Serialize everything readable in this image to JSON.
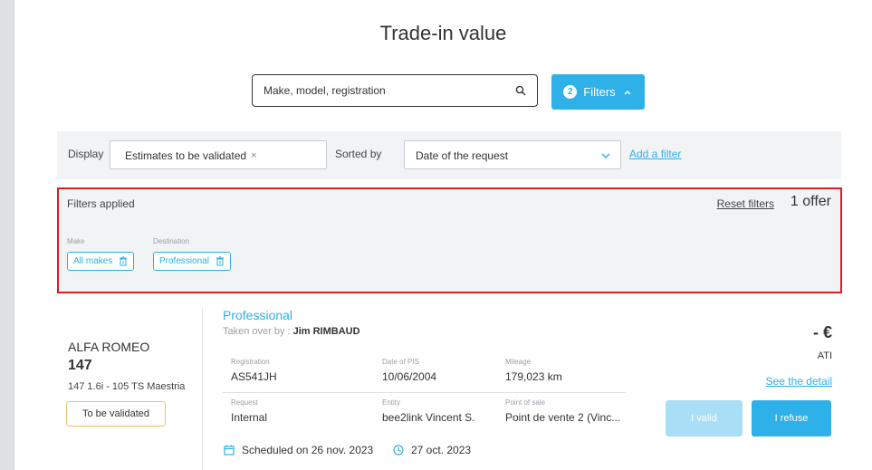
{
  "page": {
    "title": "Trade-in value"
  },
  "search": {
    "placeholder": "Make, model, registration",
    "icon": "search-icon"
  },
  "filters_button": {
    "count": "2",
    "label": "Filters",
    "icon": "chevron-up-icon"
  },
  "display_bar": {
    "display_label": "Display",
    "display_chip": "Estimates to be validated",
    "display_chip_remove": "×",
    "sorted_by_label": "Sorted by",
    "sort_value": "Date of the request",
    "add_filter_label": "Add a filter"
  },
  "filters_applied": {
    "title": "Filters applied",
    "reset_label": "Reset filters",
    "offer_count": "1 offer",
    "filters": [
      {
        "label": "Make",
        "value": "All makes"
      },
      {
        "label": "Destination",
        "value": "Professional"
      }
    ]
  },
  "offer": {
    "make": "ALFA ROMEO",
    "model": "147",
    "version": "147 1.6i - 105 TS Maestria",
    "status": "To be validated",
    "destination": "Professional",
    "taken_over_label": "Taken over by :",
    "taken_over_by": "Jim RIMBAUD",
    "registration_label": "Registration",
    "registration": "AS541JH",
    "date_pis_label": "Date of PIS",
    "date_pis": "10/06/2004",
    "mileage_label": "Mileage",
    "mileage": "179,023 km",
    "request_label": "Request",
    "request": "Internal",
    "entity_label": "Entity",
    "entity": "bee2link Vincent S.",
    "pos_label": "Point of sale",
    "pos": "Point de vente 2 (Vinc...",
    "scheduled": "Scheduled on 26 nov. 2023",
    "created": "27 oct. 2023",
    "price": "- €",
    "price_unit": "ATI",
    "see_detail": "See the detail",
    "valid_button": "I valid",
    "refuse_button": "I refuse"
  },
  "colors": {
    "accent": "#2eb0e8",
    "highlight_border": "#d81f26",
    "badge_border": "#e8c26b",
    "disabled_button": "#a8dff6"
  }
}
